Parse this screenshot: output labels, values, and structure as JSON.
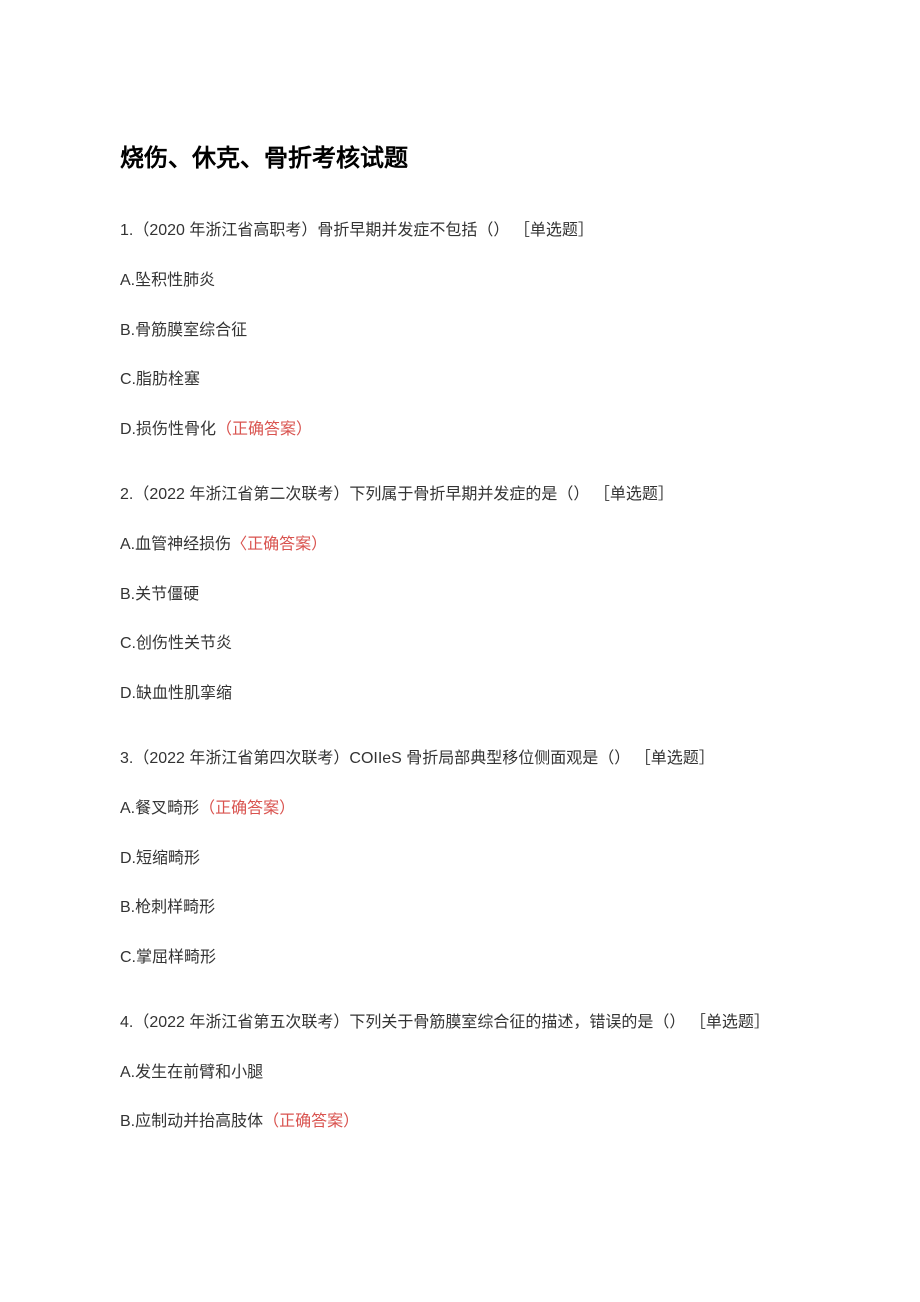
{
  "title": "烧伤、休克、骨折考核试题",
  "questions": [
    {
      "stem": "1.（2020 年浙江省高职考）骨折早期并发症不包括（） ［单选题］",
      "options": [
        {
          "label": "A.坠积性肺炎",
          "correct": false
        },
        {
          "label": "B.骨筋膜室综合征",
          "correct": false
        },
        {
          "label": "C.脂肪栓塞",
          "correct": false
        },
        {
          "label": "D.损伤性骨化",
          "correct": true
        }
      ]
    },
    {
      "stem": "2.（2022 年浙江省第二次联考）下列属于骨折早期并发症的是（） ［单选题］",
      "options": [
        {
          "label": "A.血管神经损伤",
          "correct": true,
          "marker": "〈正确答案）"
        },
        {
          "label": "B.关节僵硬",
          "correct": false
        },
        {
          "label": "C.创伤性关节炎",
          "correct": false
        },
        {
          "label": "D.缺血性肌挛缩",
          "correct": false
        }
      ]
    },
    {
      "stem": "3.（2022 年浙江省第四次联考）COIIeS 骨折局部典型移位侧面观是（） ［单选题］",
      "options": [
        {
          "label": "A.餐叉畸形",
          "correct": true
        },
        {
          "label": "D.短缩畸形",
          "correct": false
        },
        {
          "label": "B.枪刺样畸形",
          "correct": false
        },
        {
          "label": "C.掌屈样畸形",
          "correct": false
        }
      ]
    },
    {
      "stem": "4.（2022 年浙江省第五次联考）下列关于骨筋膜室综合征的描述，错误的是（） ［单选题］",
      "options": [
        {
          "label": "A.发生在前臂和小腿",
          "correct": false
        },
        {
          "label": "B.应制动并抬高肢体",
          "correct": true
        }
      ]
    }
  ],
  "correctMarker": "（正确答案）"
}
